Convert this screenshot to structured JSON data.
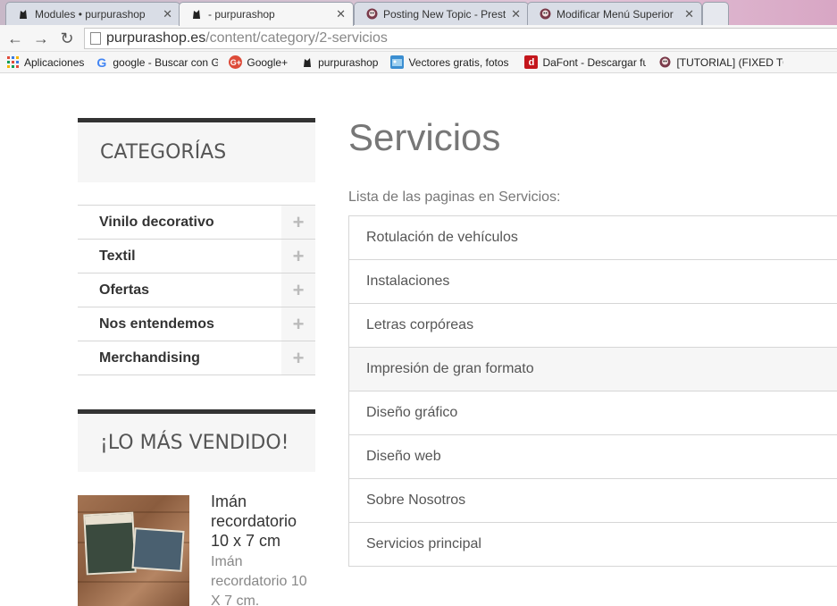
{
  "tabs": [
    {
      "title": "Modules • purpurashop",
      "close": "✕"
    },
    {
      "title": "- purpurashop",
      "close": "✕"
    },
    {
      "title": "Posting New Topic - Prest",
      "close": "✕"
    },
    {
      "title": "Modificar Menú Superior",
      "close": "✕"
    }
  ],
  "nav": {
    "back": "←",
    "forward": "→",
    "reload": "↻"
  },
  "address": {
    "host": "purpurashop.es",
    "path": "/content/category/2-servicios"
  },
  "bookmarks": [
    {
      "label": "Aplicaciones",
      "icon": "apps-grid-icon"
    },
    {
      "label": "google - Buscar con G",
      "icon": "google-icon"
    },
    {
      "label": "Google+",
      "icon": "google-plus-icon"
    },
    {
      "label": "purpurashop",
      "icon": "purpurashop-icon"
    },
    {
      "label": "Vectores gratis, fotos",
      "icon": "freepik-icon"
    },
    {
      "label": "DaFont - Descargar fu",
      "icon": "dafont-icon"
    },
    {
      "label": "[TUTORIAL] (FIXED TO",
      "icon": "prestashop-icon"
    }
  ],
  "sidebar": {
    "categories_title": "CATEGORÍAS",
    "categories": [
      {
        "label": "Vinilo decorativo"
      },
      {
        "label": "Textil"
      },
      {
        "label": "Ofertas"
      },
      {
        "label": "Nos entendemos"
      },
      {
        "label": "Merchandising"
      }
    ],
    "expand_symbol": "+",
    "best_sellers_title": "¡LO MÁS VENDIDO!",
    "product": {
      "name": "Imán recordatorio 10 x 7 cm",
      "description": "Imán recordatorio 10 X 7 cm."
    }
  },
  "main": {
    "title": "Servicios",
    "subtitle": "Lista de las paginas en Servicios:",
    "pages": [
      "Rotulación de vehículos",
      "Instalaciones",
      "Letras corpóreas",
      "Impresión de gran formato",
      "Diseño gráfico",
      "Diseño web",
      "Sobre Nosotros",
      "Servicios principal"
    ]
  }
}
